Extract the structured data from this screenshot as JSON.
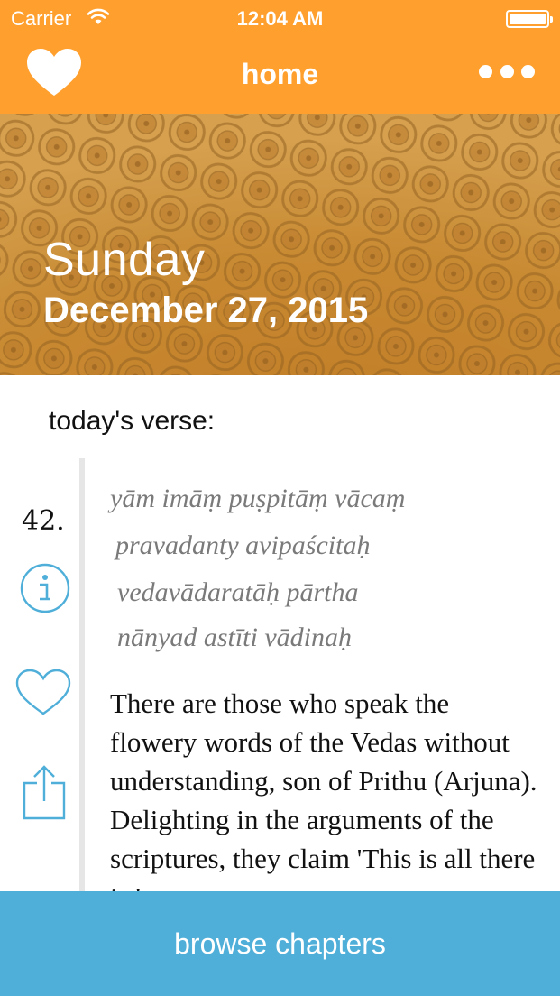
{
  "status_bar": {
    "carrier": "Carrier",
    "time": "12:04 AM",
    "icons": [
      "wifi-icon",
      "battery-icon"
    ]
  },
  "nav": {
    "title": "home",
    "left_icon": "heart-icon",
    "right_icon": "more-icon"
  },
  "banner": {
    "day": "Sunday",
    "date": "December 27, 2015"
  },
  "verse": {
    "heading": "today's verse:",
    "number": "42.",
    "sanskrit": [
      "yām imāṃ puṣpitāṃ vācaṃ",
      "pravadanty avipaścitaḥ",
      "vedavādaratāḥ pārtha",
      "nānyad astīti vādinaḥ"
    ],
    "translation": "There are those who speak the flowery words of the Vedas without understanding, son of Prithu (Arjuna). Delighting in the arguments of the scriptures, they claim 'This is all there is.'",
    "actions": [
      "info-icon",
      "favorite-icon",
      "share-icon"
    ]
  },
  "footer": {
    "browse_label": "browse chapters"
  },
  "colors": {
    "nav_bar": "#FFA02E",
    "banner": "#C98A32",
    "browse_button": "#4FAFD9",
    "icon_blue": "#4FAFD9",
    "sanskrit_text": "#7a7a7a"
  }
}
